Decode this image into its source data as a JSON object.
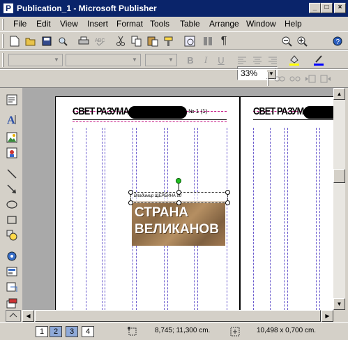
{
  "window": {
    "title": "Publication_1 - Microsoft Publisher",
    "buttons": [
      "_",
      "□",
      "×"
    ]
  },
  "menu": [
    "File",
    "Edit",
    "View",
    "Insert",
    "Format",
    "Tools",
    "Table",
    "Arrange",
    "Window",
    "Help"
  ],
  "toolbar": {
    "zoom": "33%",
    "standard_icons": [
      "new-icon",
      "open-icon",
      "save-icon",
      "search-icon",
      "print-icon",
      "spellcheck-icon",
      "cut-icon",
      "copy-icon",
      "paste-icon",
      "format-painter-icon",
      "insert-object-icon",
      "columns-icon",
      "pilcrow-icon",
      "zoom-out-icon",
      "zoom-in-icon",
      "help-icon"
    ],
    "glyphs": {
      "pilcrow": "¶",
      "bold": "B",
      "italic": "I",
      "underline": "U"
    }
  },
  "formatting": {
    "font_style": "",
    "font_name": "",
    "font_size": ""
  },
  "document": {
    "masthead_left": "СВЕТ РАЗУМА",
    "masthead_right": "СВЕТ РАЗУМА",
    "issue": "№ 1 (1)",
    "caption": "Владимир ЩЕРБИНА 00",
    "headline_line1": "СТРАНА",
    "headline_line2": "ВЕЛИКАНОВ"
  },
  "status": {
    "pages": [
      "1",
      "2",
      "3",
      "4"
    ],
    "position": "8,745; 11,300 cm.",
    "size": "10,498 x   0,700 cm."
  },
  "colors": {
    "titlebar": "#0a246a",
    "workspace": "#a9a9a9",
    "face": "#d4d0c8",
    "fill_highlight": "#ffff00",
    "font_color": "#0000ff"
  }
}
